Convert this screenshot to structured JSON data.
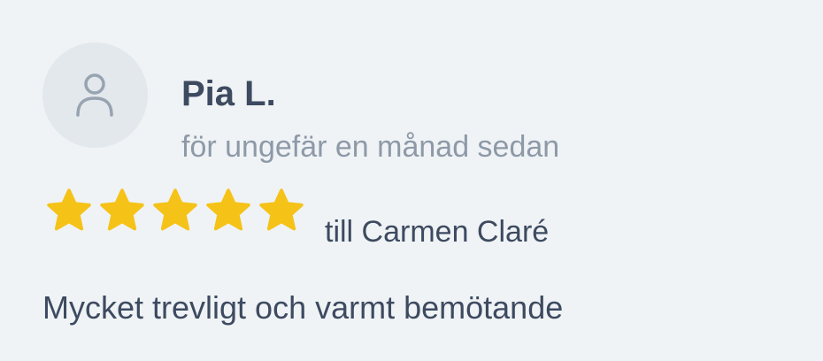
{
  "review": {
    "reviewer_name": "Pia L.",
    "time_ago": "för ungefär en månad sedan",
    "rating": 5,
    "rating_max": 5,
    "recipient": "till Carmen Claré",
    "text": "Mycket trevligt och varmt bemötande",
    "avatar_icon": "user-icon",
    "star_icon": "star-icon"
  },
  "colors": {
    "background": "#eff3f5",
    "avatar_bg": "#e2e8ec",
    "star": "#f5c218",
    "name": "#3d4a60",
    "muted": "#8e99a8"
  }
}
